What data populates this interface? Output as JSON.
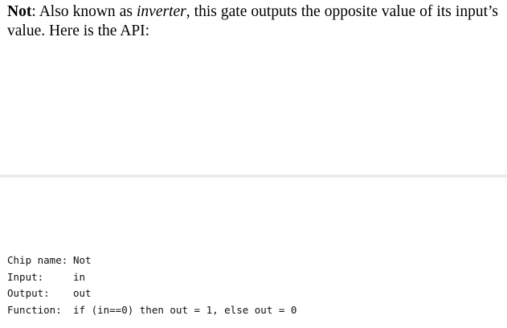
{
  "description": {
    "term": "Not",
    "after_term": ": Also known as ",
    "alias": "inverter",
    "rest": ", this gate outputs the opposite value of its input’s value. Here is the API:"
  },
  "api": [
    {
      "key": "Chip name:",
      "value": "Not"
    },
    {
      "key": "Input:",
      "value": "in"
    },
    {
      "key": "Output:",
      "value": "out"
    },
    {
      "key": "Function:",
      "value": "if (in==0) then out = 1, else out = 0"
    }
  ]
}
